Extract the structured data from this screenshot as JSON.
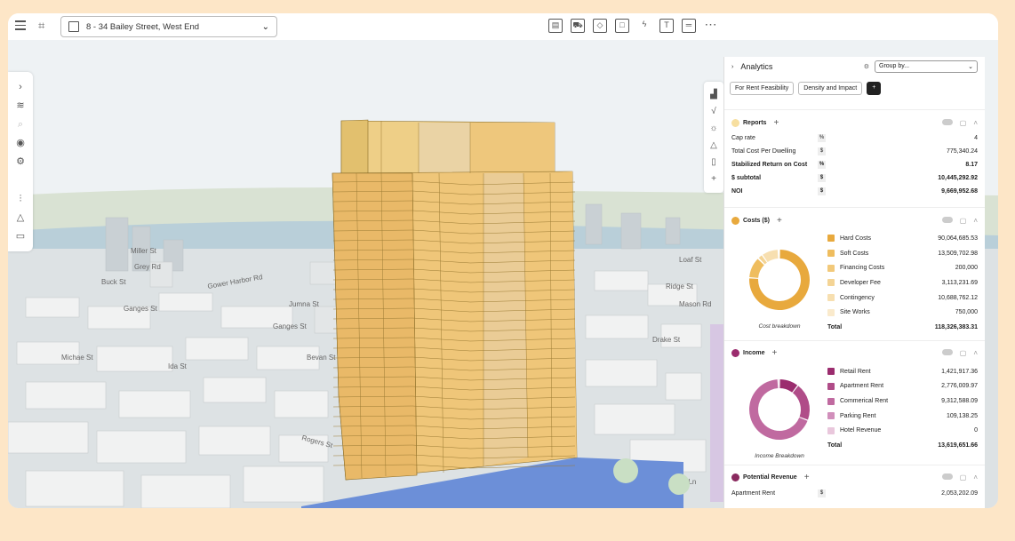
{
  "topbar": {
    "address": "8 - 34 Bailey Street, West End",
    "tools": [
      "building-icon",
      "truck-icon",
      "cube-icon",
      "frame-icon",
      "bolt-icon",
      "text-icon",
      "ruler-icon",
      "more-icon"
    ]
  },
  "map": {
    "street_labels": [
      "Miller St",
      "Grey Rd",
      "Buck St",
      "Gower Harbor Rd",
      "Ganges St",
      "Ganges St",
      "Jumna St",
      "Ridge St",
      "Michae St",
      "Ida St",
      "Bevan St",
      "Rogers St",
      "Drake St",
      "Mara Ln",
      "Loaf St",
      "Mason Rd"
    ]
  },
  "panel": {
    "title": "Analytics",
    "group_by": "Group by...",
    "chips": [
      "For Rent Feasibility",
      "Density and Impact"
    ],
    "reports": {
      "title": "Reports",
      "rows": [
        {
          "label": "Cap rate",
          "unit": "%",
          "value": "4",
          "bold": false
        },
        {
          "label": "Total Cost Per Dwelling",
          "unit": "$",
          "value": "775,340.24",
          "bold": false
        },
        {
          "label": "Stabilized Return on Cost",
          "unit": "%",
          "value": "8.17",
          "bold": true
        },
        {
          "label": "$ subtotal",
          "unit": "$",
          "value": "10,445,292.92",
          "bold": true
        },
        {
          "label": "NOI",
          "unit": "$",
          "value": "9,669,952.68",
          "bold": true
        }
      ]
    },
    "costs": {
      "title": "Costs ($)",
      "caption": "Cost breakdown",
      "items": [
        {
          "label": "Hard Costs",
          "value": "90,064,685.53",
          "color": "#e8a93d",
          "share": 0.761
        },
        {
          "label": "Soft Costs",
          "value": "13,509,702.98",
          "color": "#efbd5e",
          "share": 0.114
        },
        {
          "label": "Financing Costs",
          "value": "200,000",
          "color": "#f2c97a",
          "share": 0.002
        },
        {
          "label": "Developer Fee",
          "value": "3,113,231.69",
          "color": "#f4d495",
          "share": 0.026
        },
        {
          "label": "Contingency",
          "value": "10,688,762.12",
          "color": "#f7dfb0",
          "share": 0.09
        },
        {
          "label": "Site Works",
          "value": "750,000",
          "color": "#faeacc",
          "share": 0.006
        }
      ],
      "total_label": "Total",
      "total": "118,326,383.31"
    },
    "income": {
      "title": "Income",
      "caption": "Income Breakdown",
      "items": [
        {
          "label": "Retail Rent",
          "value": "1,421,917.36",
          "color": "#9b2c6e",
          "share": 0.104
        },
        {
          "label": "Apartment Rent",
          "value": "2,776,009.97",
          "color": "#b04c88",
          "share": 0.204
        },
        {
          "label": "Commerical Rent",
          "value": "9,312,588.09",
          "color": "#c06aa0",
          "share": 0.684
        },
        {
          "label": "Parking Rent",
          "value": "109,138.25",
          "color": "#d18fbb",
          "share": 0.008
        },
        {
          "label": "Hotel Revenue",
          "value": "0",
          "color": "#e9c7dc",
          "share": 0
        }
      ],
      "total_label": "Total",
      "total": "13,619,651.66"
    },
    "potential": {
      "title": "Potential Revenue",
      "rows": [
        {
          "label": "Apartment Rent",
          "unit": "$",
          "value": "2,053,202.09"
        }
      ]
    }
  }
}
